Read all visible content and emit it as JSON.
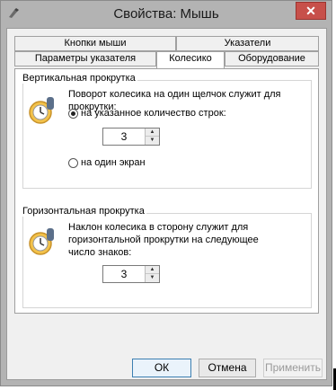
{
  "window": {
    "title": "Свойства: Мышь",
    "close_glyph": "✕",
    "icon": "mouse-app-icon"
  },
  "tabs": {
    "row1": [
      "Кнопки мыши",
      "Указатели"
    ],
    "row2": [
      "Параметры указателя",
      "Колесико",
      "Оборудование"
    ],
    "active": "Колесико"
  },
  "vertical": {
    "group_label": "Вертикальная прокрутка",
    "description": "Поворот колесика на один щелчок служит для прокрутки:",
    "option_lines_label": "на указанное количество строк:",
    "option_lines_checked": true,
    "lines_value": "3",
    "option_screen_label": "на один экран",
    "option_screen_checked": false
  },
  "horizontal": {
    "group_label": "Горизонтальная прокрутка",
    "description_line1": "Наклон колесика в сторону служит для",
    "description_line2": "горизонтальной прокрутки на следующее",
    "description_line3": "число знаков:",
    "chars_value": "3"
  },
  "buttons": {
    "ok": "ОК",
    "cancel": "Отмена",
    "apply": "Применить"
  },
  "spin": {
    "up_glyph": "▲",
    "down_glyph": "▼"
  },
  "colors": {
    "close_button": "#c7504a",
    "window_frame": "#b3b3b3",
    "dialog_bg": "#f0f0f0"
  }
}
